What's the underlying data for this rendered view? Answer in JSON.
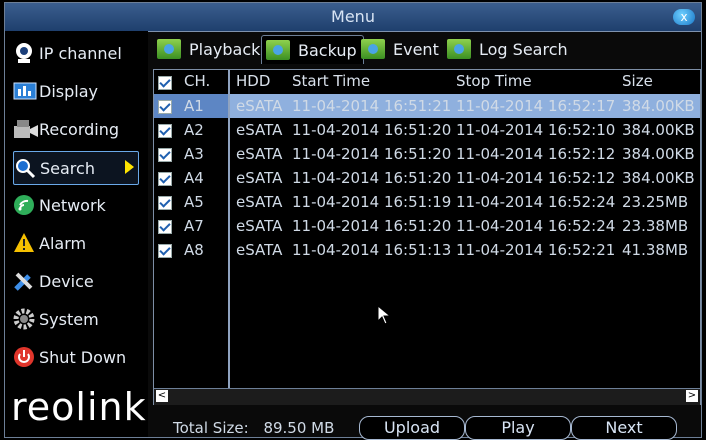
{
  "window": {
    "title": "Menu",
    "close_label": "x"
  },
  "sidebar": {
    "items": [
      {
        "label": "IP channel",
        "icon": "camera-icon"
      },
      {
        "label": "Display",
        "icon": "display-icon"
      },
      {
        "label": "Recording",
        "icon": "recording-icon"
      },
      {
        "label": "Search",
        "icon": "search-icon"
      },
      {
        "label": "Network",
        "icon": "network-icon"
      },
      {
        "label": "Alarm",
        "icon": "alarm-icon"
      },
      {
        "label": "Device",
        "icon": "device-icon"
      },
      {
        "label": "System",
        "icon": "system-icon"
      },
      {
        "label": "Shut Down",
        "icon": "power-icon"
      }
    ],
    "active_index": 3,
    "logo_text": "reolink"
  },
  "tabs": [
    {
      "label": "Playback"
    },
    {
      "label": "Backup"
    },
    {
      "label": "Event"
    },
    {
      "label": "Log Search"
    }
  ],
  "active_tab": 1,
  "table": {
    "headers": {
      "ch": "CH.",
      "hdd": "HDD",
      "start": "Start Time",
      "stop": "Stop Time",
      "size": "Size"
    },
    "rows": [
      {
        "ch": "A1",
        "hdd": "eSATA",
        "start": "11-04-2014 16:51:21",
        "stop": "11-04-2014 16:52:17",
        "size": "384.00KB",
        "selected": true
      },
      {
        "ch": "A2",
        "hdd": "eSATA",
        "start": "11-04-2014 16:51:20",
        "stop": "11-04-2014 16:52:10",
        "size": "384.00KB"
      },
      {
        "ch": "A3",
        "hdd": "eSATA",
        "start": "11-04-2014 16:51:20",
        "stop": "11-04-2014 16:52:12",
        "size": "384.00KB"
      },
      {
        "ch": "A4",
        "hdd": "eSATA",
        "start": "11-04-2014 16:51:20",
        "stop": "11-04-2014 16:52:12",
        "size": "384.00KB"
      },
      {
        "ch": "A5",
        "hdd": "eSATA",
        "start": "11-04-2014 16:51:19",
        "stop": "11-04-2014 16:52:24",
        "size": "23.25MB"
      },
      {
        "ch": "A7",
        "hdd": "eSATA",
        "start": "11-04-2014 16:51:20",
        "stop": "11-04-2014 16:52:24",
        "size": "23.38MB"
      },
      {
        "ch": "A8",
        "hdd": "eSATA",
        "start": "11-04-2014 16:51:13",
        "stop": "11-04-2014 16:52:21",
        "size": "41.38MB"
      }
    ]
  },
  "scrollbar": {
    "left_arrow": "<",
    "right_arrow": ">"
  },
  "footer": {
    "total_label": "Total Size:",
    "total_value": "89.50 MB",
    "buttons": {
      "upload": "Upload",
      "play": "Play",
      "next": "Next"
    }
  },
  "colors": {
    "selection": "#8fb0de",
    "titlebar": "#2c4f80",
    "accent": "#6aa9e9"
  }
}
